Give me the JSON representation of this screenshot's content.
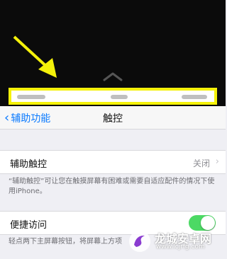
{
  "nav": {
    "back_label": "辅助功能",
    "title": "触控"
  },
  "assistive_touch": {
    "label": "辅助触控",
    "value": "关闭",
    "footnote": "“辅助触控”可让您在触摸屏幕有困难或需要自适应配件的情况下使用iPhone。"
  },
  "reachability": {
    "label": "便捷访问",
    "enabled": true,
    "footnote": "轻点两下主屏幕按钮，将屏幕上方项"
  },
  "watermark": {
    "name": "龙城安卓网",
    "url": "www.lcjrfg.com"
  },
  "colors": {
    "highlight": "#f5f20a",
    "link": "#0a7aff",
    "toggle_on": "#4cd964"
  }
}
